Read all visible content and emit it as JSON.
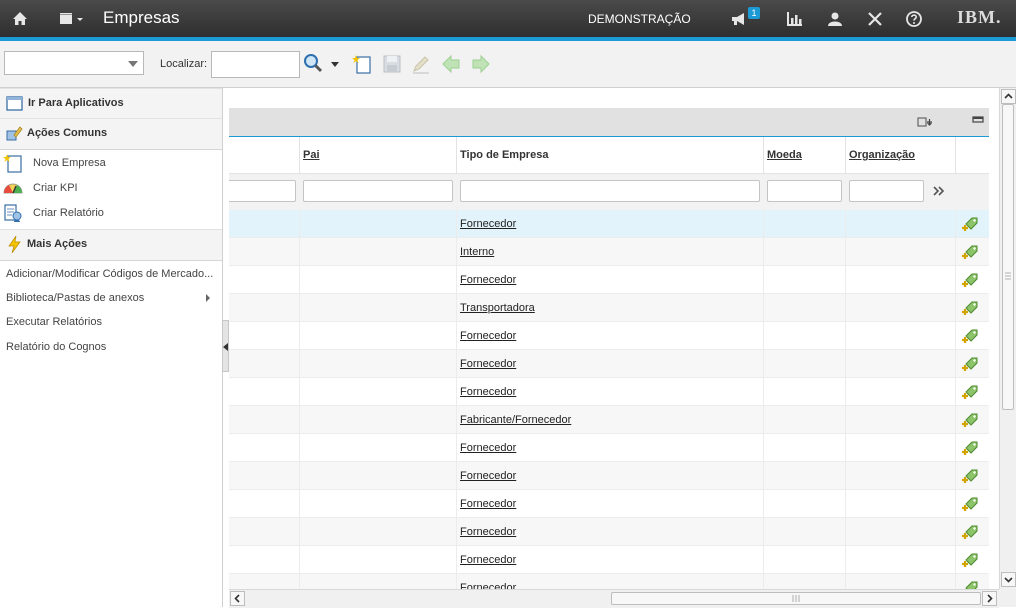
{
  "header": {
    "app_title": "Empresas",
    "mode_label": "DEMONSTRAÇÃO",
    "notification_count": "1",
    "brand": "IBM.",
    "icons": [
      "home-icon",
      "menu-icon",
      "announcement-icon",
      "chart-icon",
      "user-icon",
      "close-icon",
      "help-icon"
    ]
  },
  "toolbar": {
    "find_label": "Localizar:",
    "find_value": "",
    "query_selected": ""
  },
  "sidebar": {
    "goto_label": "Ir Para Aplicativos",
    "common_actions_label": "Ações Comuns",
    "common_actions": [
      {
        "label": "Nova Empresa",
        "icon": "new-record-icon"
      },
      {
        "label": "Criar KPI",
        "icon": "kpi-gauge-icon"
      },
      {
        "label": "Criar Relatório",
        "icon": "report-icon"
      }
    ],
    "more_actions_label": "Mais Ações",
    "more_actions": [
      {
        "label": "Adicionar/Modificar Códigos de Mercado..."
      },
      {
        "label": "Biblioteca/Pastas de anexos"
      },
      {
        "label": "Executar Relatórios"
      },
      {
        "label": "Relatório do Cognos"
      }
    ]
  },
  "table": {
    "columns": {
      "pai": "Pai",
      "tipo": "Tipo de Empresa",
      "moeda": "Moeda",
      "organizacao": "Organização"
    },
    "rows": [
      {
        "tipo": "Fornecedor"
      },
      {
        "tipo": "Interno"
      },
      {
        "tipo": "Fornecedor"
      },
      {
        "tipo": "Transportadora"
      },
      {
        "tipo": "Fornecedor"
      },
      {
        "tipo": "Fornecedor"
      },
      {
        "tipo": "Fornecedor"
      },
      {
        "tipo": "Fabricante/Fornecedor"
      },
      {
        "tipo": "Fornecedor"
      },
      {
        "tipo": "Fornecedor"
      },
      {
        "tipo": "Fornecedor"
      },
      {
        "tipo": "Fornecedor"
      },
      {
        "tipo": "Fornecedor"
      },
      {
        "tipo": "Fornecedor"
      }
    ]
  },
  "colors": {
    "accent": "#1c9ad6",
    "topbar": "#3a3a3a",
    "selected_row": "#e2f3fb"
  }
}
